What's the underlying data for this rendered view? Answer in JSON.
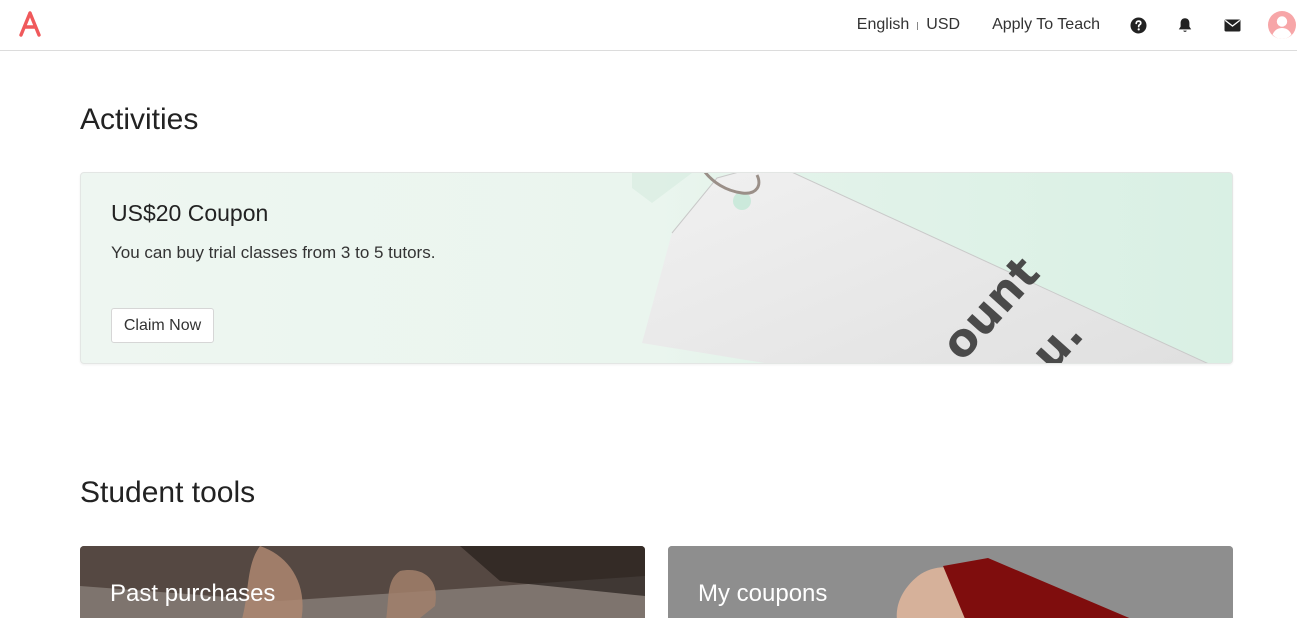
{
  "nav": {
    "language": "English",
    "currency": "USD",
    "apply_label": "Apply To Teach",
    "icons": [
      "help-icon",
      "bell-icon",
      "mail-icon",
      "user-avatar-icon"
    ],
    "brand_color": "#f0595b"
  },
  "activities": {
    "title": "Activities",
    "coupon": {
      "title": "US$20 Coupon",
      "description": "You can buy trial classes from 3 to 5 tutors.",
      "button": "Claim Now"
    }
  },
  "student_tools": {
    "title": "Student tools",
    "cards": [
      {
        "label": "Past purchases"
      },
      {
        "label": "My coupons"
      }
    ]
  }
}
